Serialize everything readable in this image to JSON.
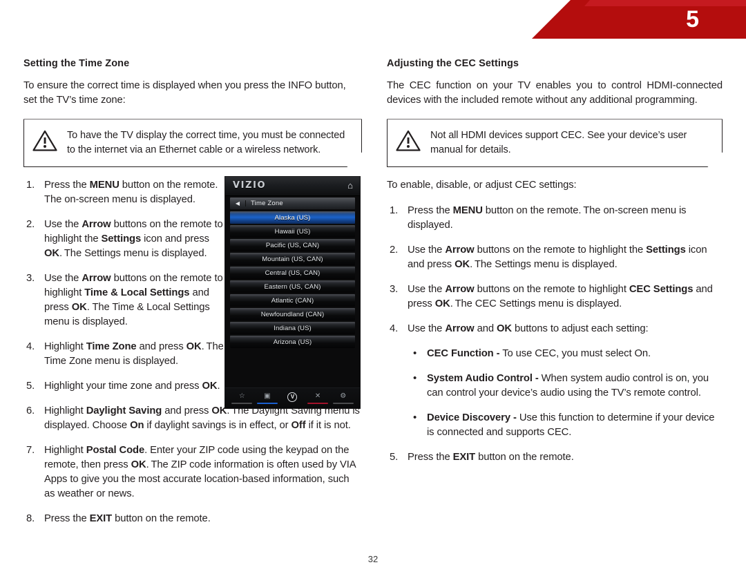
{
  "header": {
    "chapter_number": "5",
    "banner_color": "#b40d0d",
    "banner_accent_color": "#c51a20"
  },
  "left_column": {
    "heading": "Setting the Time Zone",
    "intro": "To ensure the correct time is displayed when you press the INFO button, set the TV’s time zone:",
    "note": {
      "icon": "warning-triangle-icon",
      "text": "To have the TV display the correct time, you must be connected to the internet via an Ethernet cable or a wireless network."
    },
    "steps": [
      {
        "num": "1.",
        "html": "Press the <b>MENU</b> button on the remote. The on-screen menu is displayed."
      },
      {
        "num": "2.",
        "html": "Use the <b>Arrow</b> buttons on the remote to highlight the <b>Settings</b> icon and press <b>OK</b>. The Settings menu is displayed."
      },
      {
        "num": "3.",
        "html": "Use the <b>Arrow</b> buttons on the remote to highlight <b>Time &amp; Local Settings</b> and press <b>OK</b>. The Time &amp; Local Settings menu is displayed."
      },
      {
        "num": "4.",
        "html": "Highlight <b>Time Zone</b> and press <b>OK</b>. The Time Zone menu is displayed."
      },
      {
        "num": "5.",
        "html": "Highlight your time zone and press <b>OK</b>."
      }
    ],
    "steps_wide": [
      {
        "num": "6.",
        "html": "Highlight <b>Daylight Saving</b> and press <b>OK</b>. The Daylight Saving menu is displayed. Choose <b>On</b> if daylight savings is in effect, or <b>Off</b> if it is not."
      },
      {
        "num": "7.",
        "html": "Highlight <b>Postal Code</b>. Enter your ZIP code using the keypad on the remote, then press <b>OK</b>. The ZIP code information is often used by VIA Apps to give you the most accurate location-based information, such as weather or news."
      },
      {
        "num": "8.",
        "html": "Press the <b>EXIT</b> button on the remote."
      }
    ]
  },
  "right_column": {
    "heading": "Adjusting the CEC Settings",
    "intro": "The CEC function on your TV enables you to control HDMI-connected devices with the included remote without any additional programming.",
    "note": {
      "icon": "warning-triangle-icon",
      "text": "Not all HDMI devices support CEC. See your device’s user manual for details."
    },
    "lead_in": "To enable, disable, or adjust CEC settings:",
    "steps": [
      {
        "num": "1.",
        "html": "Press the <b>MENU</b> button on the remote. The on-screen menu is displayed."
      },
      {
        "num": "2.",
        "html": "Use the <b>Arrow</b> buttons on the remote to highlight the <b>Settings</b> icon and press <b>OK</b>. The Settings menu is displayed."
      },
      {
        "num": "3.",
        "html": "Use the <b>Arrow</b> buttons on the remote to highlight <b>CEC Settings</b> and press <b>OK</b>. The CEC Settings menu is displayed."
      },
      {
        "num": "4.",
        "html": "Use the <b>Arrow</b> and <b>OK</b> buttons to adjust each setting:"
      }
    ],
    "bullets": [
      {
        "html": "<b>CEC Function -</b> To use CEC, you must select On."
      },
      {
        "html": "<b>System Audio Control -</b> When system audio control is on, you can control your device’s audio using the TV’s remote control."
      },
      {
        "html": "<b>Device Discovery -</b> Use this function to determine if your device is connected and supports CEC."
      }
    ],
    "final_step": {
      "num": "5.",
      "html": "Press the <b>EXIT</b> button on the remote."
    }
  },
  "tv_screenshot": {
    "brand": "VIZIO",
    "home_icon": "home-icon",
    "back_arrow_icon": "chevron-left-icon",
    "menu_title": "Time Zone",
    "selected_index": 0,
    "highlight_color": "#1b62c8",
    "rows": [
      "Alaska (US)",
      "Hawaii (US)",
      "Pacific (US, CAN)",
      "Mountain (US, CAN)",
      "Central (US, CAN)",
      "Eastern (US, CAN)",
      "Atlantic (CAN)",
      "Newfoundland (CAN)",
      "Indiana (US)",
      "Arizona (US)"
    ],
    "nav_items": [
      {
        "icon": "star-icon",
        "glyph": "☆",
        "underline": "gray"
      },
      {
        "icon": "picture-icon",
        "glyph": "▣",
        "underline": "blue"
      },
      {
        "icon": "vizio-v-icon",
        "glyph": "V",
        "underline": "none"
      },
      {
        "icon": "close-x-icon",
        "glyph": "✕",
        "underline": "red"
      },
      {
        "icon": "gear-icon",
        "glyph": "⚙",
        "underline": "gray"
      }
    ]
  },
  "footer": {
    "page_number": "32"
  }
}
